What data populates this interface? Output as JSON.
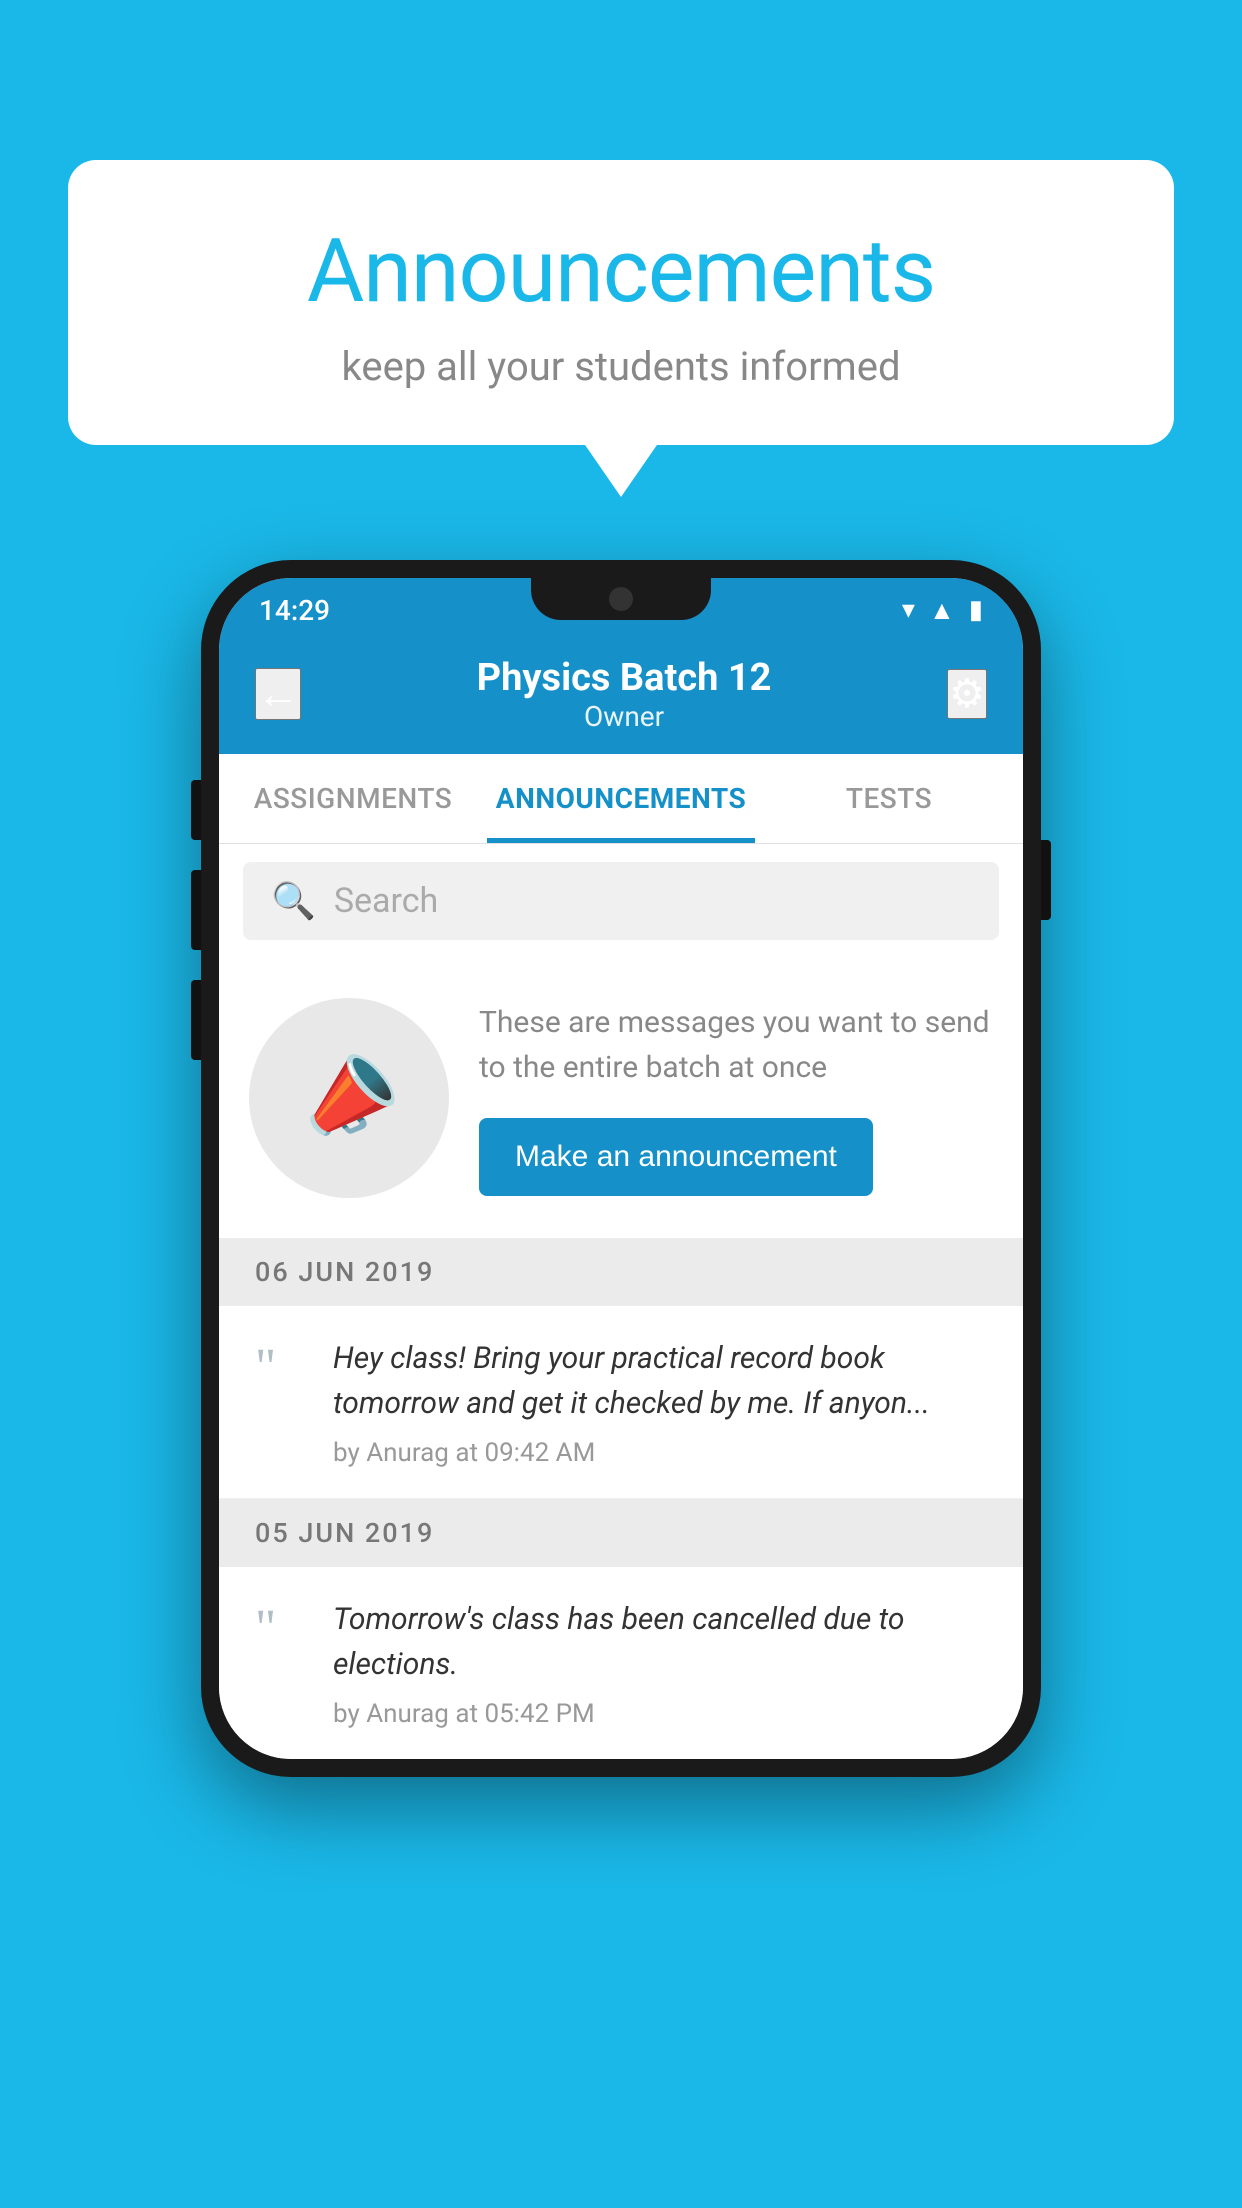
{
  "background_color": "#1ab8e8",
  "speech_bubble": {
    "title": "Announcements",
    "subtitle": "keep all your students informed"
  },
  "phone": {
    "status_bar": {
      "time": "14:29"
    },
    "header": {
      "title": "Physics Batch 12",
      "subtitle": "Owner",
      "back_label": "←",
      "settings_label": "⚙"
    },
    "tabs": [
      {
        "label": "ASSIGNMENTS",
        "active": false
      },
      {
        "label": "ANNOUNCEMENTS",
        "active": true
      },
      {
        "label": "TESTS",
        "active": false
      }
    ],
    "search": {
      "placeholder": "Search"
    },
    "promo": {
      "text": "These are messages you want to send to the entire batch at once",
      "button_label": "Make an announcement"
    },
    "announcements": [
      {
        "date": "06  JUN  2019",
        "text": "Hey class! Bring your practical record book tomorrow and get it checked by me. If anyon...",
        "meta": "by Anurag at 09:42 AM"
      },
      {
        "date": "05  JUN  2019",
        "text": "Tomorrow's class has been cancelled due to elections.",
        "meta": "by Anurag at 05:42 PM"
      }
    ]
  }
}
